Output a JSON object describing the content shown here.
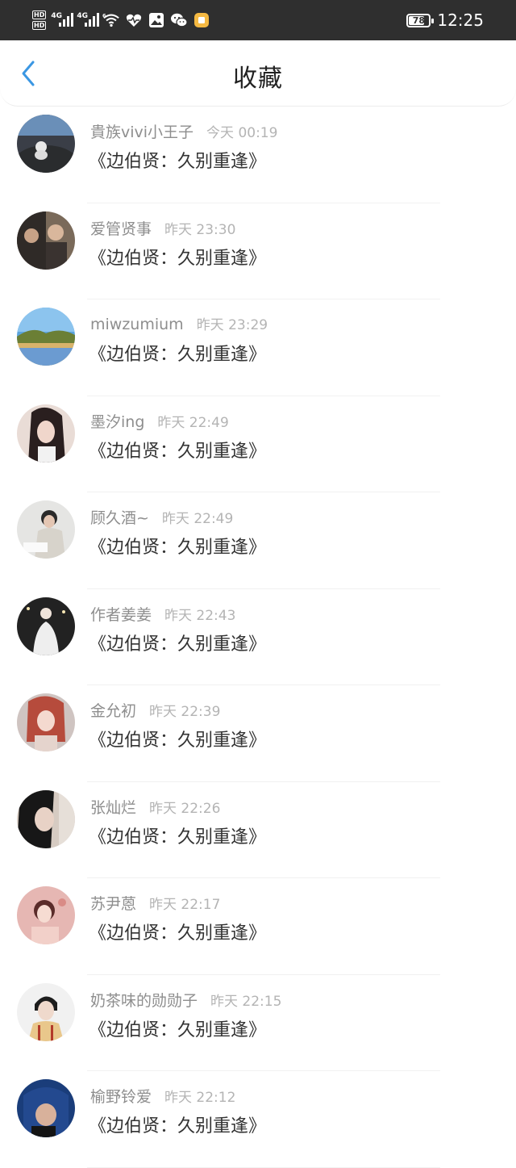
{
  "status_bar": {
    "hd1": "HD",
    "hd2": "HD",
    "network1": "4G",
    "network2": "4G",
    "wifi_gen": "6",
    "icons": [
      "wifi-icon",
      "heart-rate-icon",
      "gallery-icon",
      "wechat-icon",
      "notification-app-icon"
    ],
    "battery": "78",
    "battery_level": 0.78,
    "time": "12:25"
  },
  "header": {
    "back_icon": "chevron-left-icon",
    "title": "收藏"
  },
  "items": [
    {
      "username": "貴族vivi小王子",
      "time": "今天 00:19",
      "novel": "《边伯贤：久别重逢》"
    },
    {
      "username": "爱管贤事",
      "time": "昨天 23:30",
      "novel": "《边伯贤：久别重逢》"
    },
    {
      "username": "miwzumium",
      "time": "昨天 23:29",
      "novel": "《边伯贤：久别重逢》"
    },
    {
      "username": "墨汐ing",
      "time": "昨天 22:49",
      "novel": "《边伯贤：久别重逢》"
    },
    {
      "username": "顾久酒~",
      "time": "昨天 22:49",
      "novel": "《边伯贤：久别重逢》"
    },
    {
      "username": "作者姜姜",
      "time": "昨天 22:43",
      "novel": "《边伯贤：久别重逢》"
    },
    {
      "username": "金允初",
      "time": "昨天 22:39",
      "novel": "《边伯贤：久别重逢》"
    },
    {
      "username": "张灿烂",
      "time": "昨天 22:26",
      "novel": "《边伯贤：久别重逢》"
    },
    {
      "username": "苏尹蒽",
      "time": "昨天 22:17",
      "novel": "《边伯贤：久别重逢》"
    },
    {
      "username": "奶茶味的勋勋子",
      "time": "昨天 22:15",
      "novel": "《边伯贤：久别重逢》"
    },
    {
      "username": "榆野铃爱",
      "time": "昨天 22:12",
      "novel": "《边伯贤：久别重逢》"
    }
  ],
  "colors": {
    "status_bar_bg": "#2f2f2f",
    "accent_back": "#3b97e3",
    "username": "#8e8e8e",
    "timestamp": "#b4b4b4",
    "title_text": "#333333"
  }
}
